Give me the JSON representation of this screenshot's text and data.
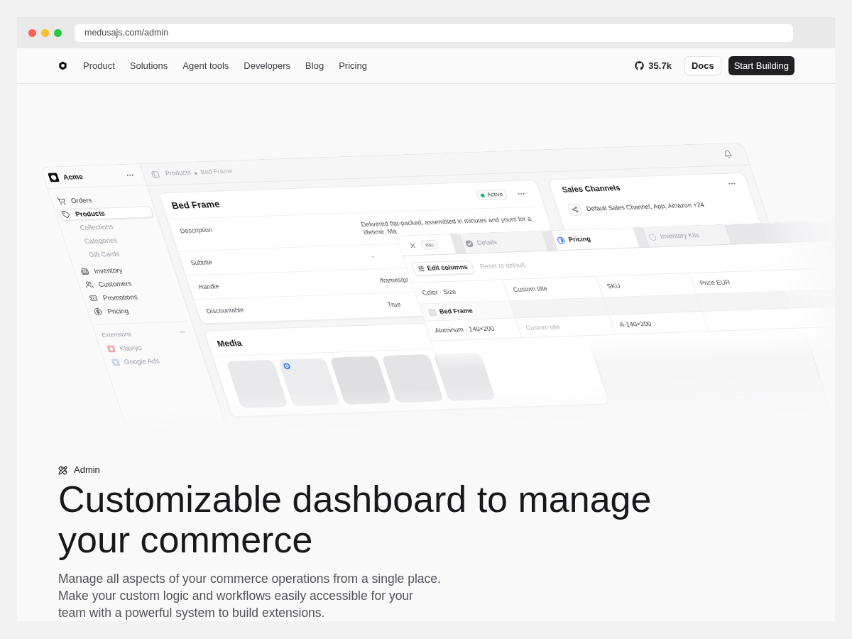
{
  "browser": {
    "url": "medusajs.com/admin"
  },
  "nav": {
    "links": [
      "Product",
      "Solutions",
      "Agent tools",
      "Developers",
      "Blog",
      "Pricing"
    ],
    "github_stars": "35.7k",
    "secondary_button": "Docs",
    "primary_button": "Start Building"
  },
  "dashboard": {
    "store_name": "Acme",
    "sidebar": {
      "items": [
        {
          "label": "Orders",
          "selected": false
        },
        {
          "label": "Products",
          "selected": true,
          "children": [
            {
              "label": "Collections",
              "selected": false
            },
            {
              "label": "Categories",
              "selected": false
            },
            {
              "label": "Gift Cards",
              "selected": false
            }
          ]
        },
        {
          "label": "Inventory",
          "selected": false
        },
        {
          "label": "Customers",
          "selected": false
        },
        {
          "label": "Promotions",
          "selected": false
        },
        {
          "label": "Pricing",
          "selected": false
        }
      ],
      "extensions": {
        "title": "Extensions",
        "items": [
          {
            "label": "Klaviyo",
            "color": "#f4a5a5"
          },
          {
            "label": "Google Ads",
            "color": "#c3d7f3"
          }
        ]
      }
    },
    "breadcrumb": [
      "Products",
      "Bed Frame"
    ],
    "product": {
      "title": "Bed Frame",
      "status": "Active",
      "rows": [
        {
          "label": "Description",
          "value": "Delivered flat-packed, assembled in minutes and yours for a lifetime. Ma"
        },
        {
          "label": "Subtitle",
          "value": "-"
        },
        {
          "label": "Handle",
          "value": "/frames/pr"
        },
        {
          "label": "Discountable",
          "value": "True"
        }
      ]
    },
    "media": {
      "title": "Media",
      "images": [
        {
          "thumbnail": false
        },
        {
          "thumbnail": true
        },
        {
          "thumbnail": false
        },
        {
          "thumbnail": false
        },
        {
          "thumbnail": false
        }
      ]
    },
    "sales_channels": {
      "title": "Sales Channels",
      "summary": "Default Sales Channel, App, Amazon +24"
    },
    "editor": {
      "close_hint": "esc",
      "tabs": [
        {
          "label": "Details",
          "kind": "completed",
          "selected": false
        },
        {
          "label": "Pricing",
          "kind": "partial",
          "selected": true
        },
        {
          "label": "Inventory Kits",
          "kind": "pending",
          "selected": false
        }
      ],
      "toolbar": {
        "edit_button": "Edit columns",
        "reset_link": "Reset to default"
      },
      "table": {
        "columns": [
          "Color · Size",
          "Custom title",
          "SKU",
          "Price EUR"
        ],
        "rows": [
          {
            "kind": "group",
            "cells": [
              {
                "kind": "text",
                "value": "Bed Frame"
              }
            ]
          },
          {
            "kind": "variant",
            "cells": [
              {
                "kind": "text",
                "value": "Aluminum · 140×200"
              },
              {
                "kind": "input",
                "placeholder": "Custom title"
              },
              {
                "kind": "input",
                "value": "A-140×200"
              }
            ]
          }
        ]
      }
    }
  },
  "hero": {
    "eyebrow": "Admin",
    "title": "Customizable dashboard to manage your commerce",
    "description": "Manage all aspects of your commerce operations from a single place. Make your custom logic and workflows easily accessible for your team with a powerful system to build extensions."
  }
}
